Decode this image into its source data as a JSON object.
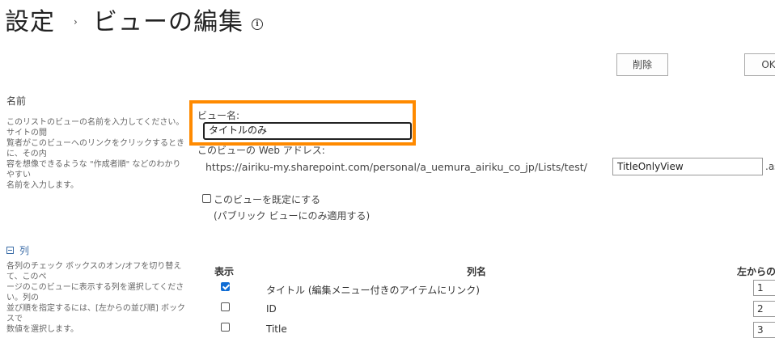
{
  "header": {
    "title": "設定",
    "separator": "›",
    "subtitle": "ビューの編集",
    "info_icon": "ⓘ"
  },
  "toolbar": {
    "delete_label": "削除",
    "ok_label": "OK"
  },
  "name_section": {
    "heading": "名前",
    "description_lines": [
      "このリストのビューの名前を入力してください。サイトの閲",
      "覧者がこのビューへのリンクをクリックするときに、その内",
      "容を想像できるような \"作成者順\" などのわかりやすい",
      "名前を入力します。"
    ],
    "view_name_label": "ビュー名:",
    "view_name_value": "タイトルのみ",
    "web_address_label": "このビューの Web アドレス:",
    "url_prefix": "https://airiku-my.sharepoint.com/personal/a_uemura_airiku_co_jp/Lists/test/",
    "url_file_value": "TitleOnlyView",
    "url_suffix": ".as",
    "default_view_label": "このビューを既定にする",
    "default_view_note": "(パブリック ビューにのみ適用する)",
    "default_view_checked": false
  },
  "columns_section": {
    "heading": "列",
    "description_lines": [
      "各列のチェック ボックスのオン/オフを切り替えて、このペ",
      "ージのこのビューに表示する列を選択してください。列の",
      "並び順を指定するには、[左からの並び順] ボックスで",
      "数値を選択します。"
    ],
    "headers": {
      "display": "表示",
      "name": "列名",
      "order": "左からの"
    },
    "rows": [
      {
        "checked": true,
        "name": "タイトル (編集メニュー付きのアイテムにリンク)",
        "order": "1"
      },
      {
        "checked": false,
        "name": "ID",
        "order": "2"
      },
      {
        "checked": false,
        "name": "Title",
        "order": "3"
      }
    ]
  },
  "colors": {
    "highlight": "#ff8a00",
    "checkbox_checked": "#0f6cd4",
    "section_link": "#3d6ea8"
  }
}
